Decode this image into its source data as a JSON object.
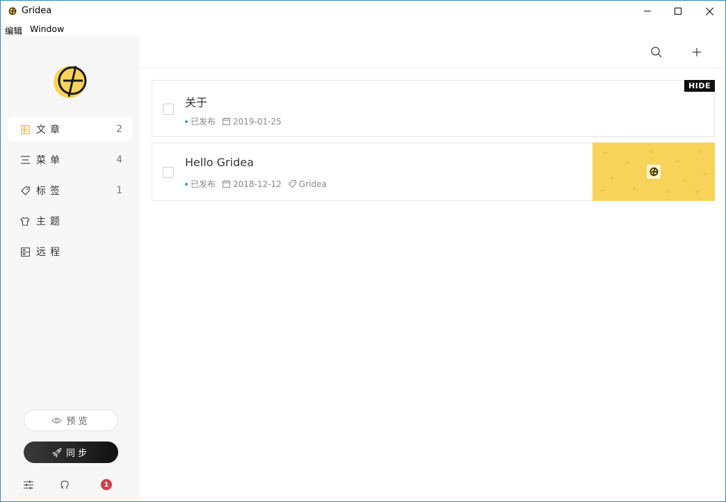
{
  "window": {
    "title": "Gridea",
    "controls": [
      "minimize",
      "maximize",
      "close"
    ]
  },
  "menubar": {
    "items": [
      "编辑",
      "Window"
    ]
  },
  "sidebar": {
    "nav": [
      {
        "label": "文章",
        "count": "2",
        "icon": "article-icon",
        "active": true
      },
      {
        "label": "菜单",
        "count": "4",
        "icon": "menu-icon",
        "active": false
      },
      {
        "label": "标签",
        "count": "1",
        "icon": "tag-icon",
        "active": false
      },
      {
        "label": "主题",
        "count": "",
        "icon": "tshirt-icon",
        "active": false
      },
      {
        "label": "远程",
        "count": "",
        "icon": "remote-icon",
        "active": false
      }
    ],
    "preview_label": "预览",
    "sync_label": "同步",
    "notification_count": "1"
  },
  "posts": [
    {
      "title": "关于",
      "status": "已发布",
      "date": "2019-01-25",
      "tag": "",
      "hidden_badge": "HIDE",
      "has_feature_image": false
    },
    {
      "title": "Hello Gridea",
      "status": "已发布",
      "date": "2018-12-12",
      "tag": "Gridea",
      "hidden_badge": "",
      "has_feature_image": true
    }
  ],
  "colors": {
    "brand_yellow": "#f8d35a",
    "published_dot": "#36b37e",
    "badge_red": "#d13e4a",
    "sync_button": "#1a1a1a"
  }
}
